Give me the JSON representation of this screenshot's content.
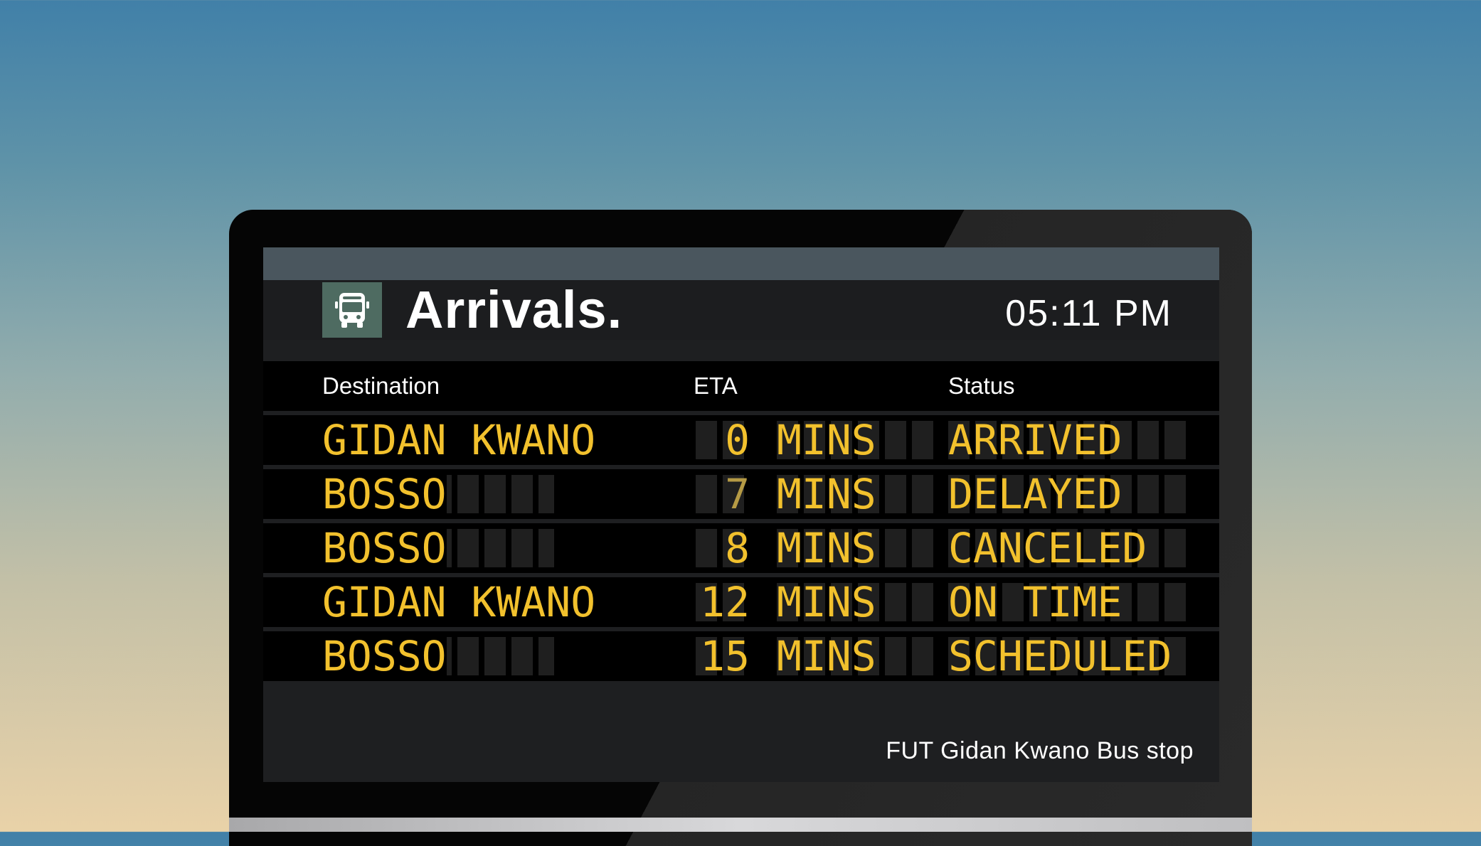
{
  "board": {
    "title": "Arrivals.",
    "time": "05:11 PM",
    "icon": "bus-icon",
    "location": "FUT Gidan Kwano Bus stop",
    "accent_color": "#f2c12d",
    "icon_bg_color": "#4e6b61"
  },
  "columns": {
    "destination": "Destination",
    "eta": "ETA",
    "status": "Status"
  },
  "arrivals": [
    {
      "destination": "GIDAN KWANO",
      "eta_value": "0",
      "eta_unit": "MINS",
      "status": "ARRIVED"
    },
    {
      "destination": "BOSSO",
      "eta_value": "7",
      "eta_unit": "MINS",
      "status": "DELAYED"
    },
    {
      "destination": "BOSSO",
      "eta_value": "8",
      "eta_unit": "MINS",
      "status": "CANCELED"
    },
    {
      "destination": "GIDAN KWANO",
      "eta_value": "12",
      "eta_unit": "MINS",
      "status": "ON TIME"
    },
    {
      "destination": "BOSSO",
      "eta_value": "15",
      "eta_unit": "MINS",
      "status": "SCHEDULED"
    }
  ]
}
